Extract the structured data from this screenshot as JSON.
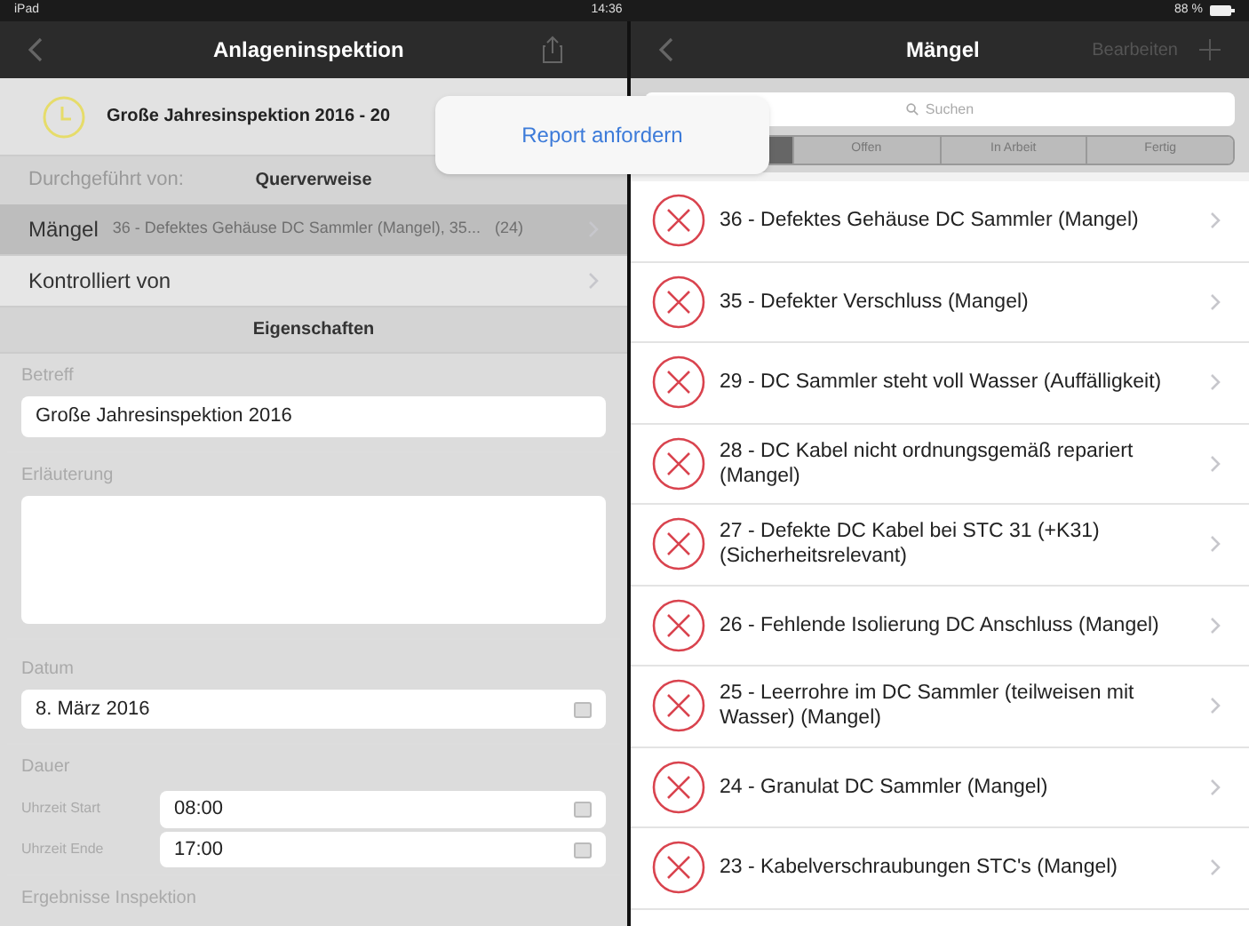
{
  "status_bar": {
    "device": "iPad",
    "time": "14:36",
    "battery": "88 %"
  },
  "left": {
    "title": "Anlageninspektion",
    "header": {
      "title": "Große Jahresinspektion 2016 - 20"
    },
    "faded_label": "Durchgeführt von:",
    "section_1": "Querverweise",
    "links": [
      {
        "label": "Mängel",
        "detail": "36 - Defektes Gehäuse DC Sammler (Mangel), 35...",
        "count": "(24)",
        "selected": true
      },
      {
        "label": "Kontrolliert von",
        "selected": false
      }
    ],
    "section_2": "Eigenschaften",
    "fields": [
      {
        "kind": "text",
        "label": "Betreff",
        "value": "Große Jahresinspektion 2016"
      },
      {
        "kind": "area",
        "label": "Erläuterung"
      },
      {
        "kind": "date",
        "label": "Datum",
        "value": "8. März 2016"
      },
      {
        "kind": "times",
        "label": "Dauer",
        "rows": [
          {
            "label": "Uhrzeit Start",
            "value": "08:00"
          },
          {
            "label": "Uhrzeit Ende",
            "value": "17:00"
          }
        ]
      },
      {
        "kind": "heading",
        "label": "Ergebnisse Inspektion"
      }
    ]
  },
  "popover": {
    "action": "Report anfordern"
  },
  "right": {
    "title": "Mängel",
    "edit": "Bearbeiten",
    "search": {
      "placeholder": "Suchen"
    },
    "segments": [
      {
        "selected": true
      },
      {
        "label": "Offen",
        "selected": false
      },
      {
        "label": "In Arbeit",
        "selected": false
      },
      {
        "label": "Fertig",
        "selected": false
      }
    ],
    "items": [
      "36 - Defektes Gehäuse DC Sammler (Mangel)",
      "35 - Defekter Verschluss  (Mangel)",
      "29 - DC Sammler steht voll Wasser (Auffälligkeit)",
      "28 - DC Kabel nicht ordnungsgemäß repariert (Mangel)",
      "27 - Defekte DC Kabel bei STC 31 (+K31) (Sicherheitsrelevant)",
      "26 - Fehlende Isolierung DC Anschluss (Mangel)",
      "25 - Leerrohre im DC Sammler (teilweisen mit Wasser) (Mangel)",
      "24 - Granulat DC Sammler  (Mangel)",
      "23 - Kabelverschraubungen STC's (Mangel)"
    ]
  }
}
